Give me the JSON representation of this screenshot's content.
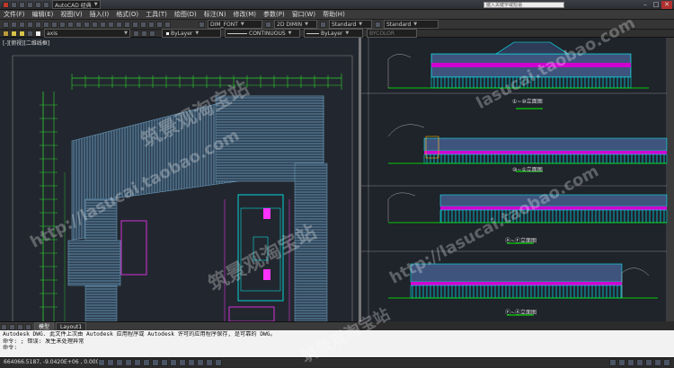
{
  "titlebar": {
    "app_title": "AutoCAD 经典",
    "search_placeholder": "键入关键字或短语",
    "min": "–",
    "max": "□",
    "close": "✕"
  },
  "menubar": {
    "items": [
      "文件(F)",
      "编辑(E)",
      "视图(V)",
      "插入(I)",
      "格式(O)",
      "工具(T)",
      "绘图(D)",
      "标注(N)",
      "修改(M)",
      "参数(P)",
      "窗口(W)",
      "帮助(H)"
    ]
  },
  "toolbar1": {
    "workspace": "AutoCAD 经典",
    "dimstyle": "DIM_FONT",
    "dimstyle2": "2D DIMIN",
    "textstyle": "Standard",
    "tablestyle": "Standard"
  },
  "toolbar2": {
    "layer": "axis",
    "color": "ByLayer",
    "linetype": "CONTINUOUS",
    "lineweight": "ByLayer",
    "plotstyle": "BYCOLOR"
  },
  "viewport_left": {
    "label": "[-][俯视][二维线框]"
  },
  "elevation_labels": [
    "①~⑩立面图",
    "⑩~①立面图",
    "Ⓐ~Ⓕ立面图",
    "Ⓕ~Ⓐ立面图"
  ],
  "layout_tabs": [
    "模型",
    "Layout1"
  ],
  "command_lines": [
    "Autodesk DWG. 此文件上次由 Autodesk 应用程序或 Autodesk 许可的应用程序保存, 是可靠的 DWG。",
    "命令: ; 错误: 发生未处理异常",
    "命令:"
  ],
  "status": {
    "coordinates": "664066.5187, -9.0420E+06 , 0.0000"
  },
  "watermarks": [
    "筑景观淘宝站",
    "http://lasucai.taobao.com",
    "筑景观淘宝站",
    "lasucai.taobao.com",
    "http://lasucai.taobao.com",
    "筑景观淘宝站"
  ],
  "colors": {
    "canvas": "#22272f",
    "roof_blue": "#5a8aa8",
    "cyan": "#00ffff",
    "magenta": "#ff00ff",
    "green": "#00ff00"
  }
}
